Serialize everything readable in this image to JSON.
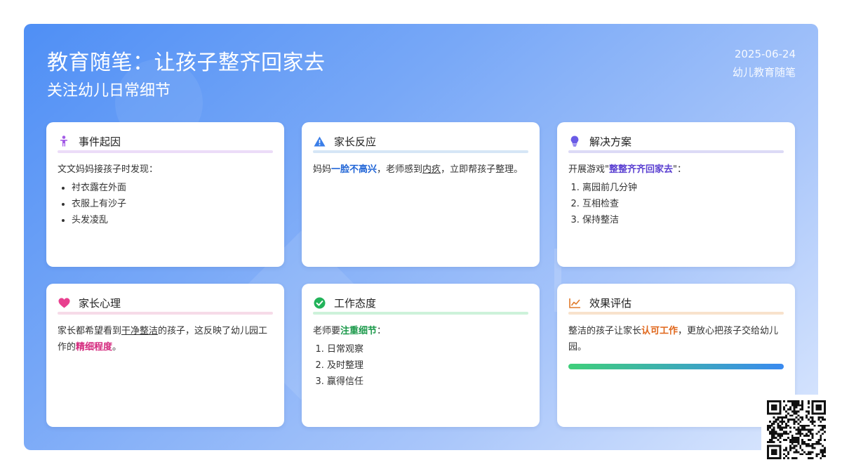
{
  "header": {
    "title": "教育随笔：让孩子整齐回家去",
    "subtitle": "关注幼儿日常细节",
    "date": "2025-06-24",
    "tag": "幼儿教育随笔"
  },
  "cards": {
    "cause": {
      "title": "事件起因",
      "icon": "child-icon",
      "color": "#a35be6",
      "intro": "文文妈妈接孩子时发现：",
      "items": [
        "衬衣露在外面",
        "衣服上有沙子",
        "头发凌乱"
      ]
    },
    "reaction": {
      "title": "家长反应",
      "icon": "warning-icon",
      "color": "#3a7ee8",
      "t1": "妈妈",
      "em": "一脸不高兴",
      "t2": "，老师感到",
      "u": "内疚",
      "t3": "，立即帮孩子整理。"
    },
    "solution": {
      "title": "解决方案",
      "icon": "lightbulb-icon",
      "color": "#6a5be6",
      "t1": "开展游戏\"",
      "em": "整整齐齐回家去",
      "t2": "\"：",
      "items": [
        "离园前几分钟",
        "互相检查",
        "保持整洁"
      ]
    },
    "psychology": {
      "title": "家长心理",
      "icon": "heart-icon",
      "color": "#e8408f",
      "t1": "家长都希望看到",
      "u": "干净整洁",
      "t2": "的孩子，这反映了幼儿园工作的",
      "em": "精细程度",
      "t3": "。"
    },
    "attitude": {
      "title": "工作态度",
      "icon": "check-circle-icon",
      "color": "#22b35a",
      "t1": "老师要",
      "em": "注重细节",
      "t2": "：",
      "items": [
        "日常观察",
        "及时整理",
        "赢得信任"
      ]
    },
    "effect": {
      "title": "效果评估",
      "icon": "chart-line-icon",
      "color": "#e07a2a",
      "t1": "整洁的孩子让家长",
      "em": "认可工作",
      "t2": "，更放心把孩子交给幼儿园。",
      "progress": 1.0
    }
  }
}
